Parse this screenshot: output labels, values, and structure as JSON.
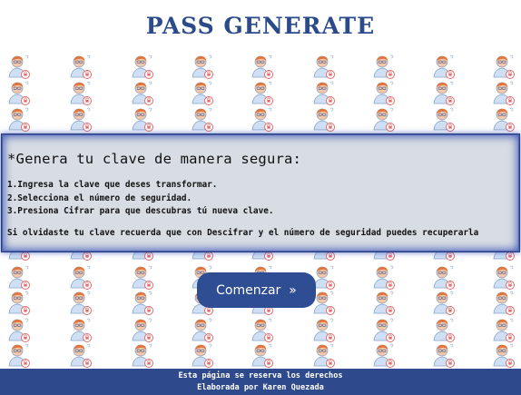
{
  "header": {
    "title": "PASS GENERATE"
  },
  "panel": {
    "heading": "*Genera tu clave de manera segura:",
    "steps": [
      "1.Ingresa la clave que deses transformar.",
      "2.Selecciona el número de seguridad.",
      "3.Presiona Cifrar para que descubras tú nueva clave."
    ],
    "note": "Si olvidaste tu clave recuerda que con Descifrar y el número de seguridad puedes recuperarla"
  },
  "start_button": {
    "label": "Comenzar",
    "arrow": "»"
  },
  "footer": {
    "line1": "Esta página se reserva los derechos",
    "line2": "Elaborada por Karen Quezada"
  },
  "background": {
    "icon": "person-with-lock-icon"
  },
  "colors": {
    "accent": "#2f4a8c",
    "title": "#2a4a8a",
    "panel_bg": "#d8dde3"
  }
}
